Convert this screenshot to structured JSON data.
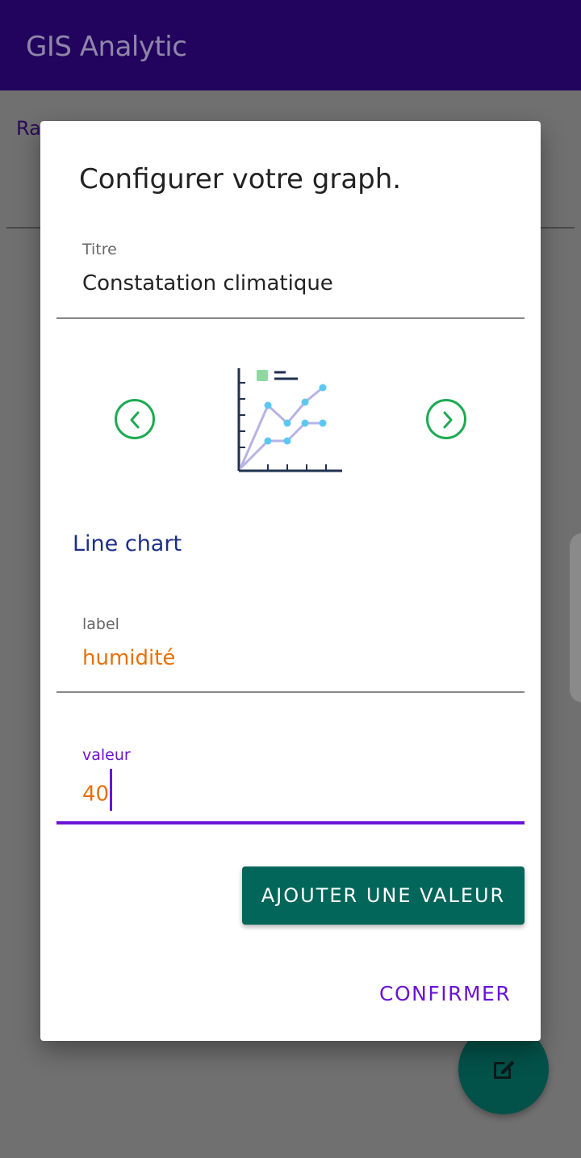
{
  "app": {
    "title": "GIS Analytic"
  },
  "background": {
    "tab_label": "Ra"
  },
  "dialog": {
    "title": "Configurer votre graph.",
    "title_field": {
      "label": "Titre",
      "value": "Constatation climatique"
    },
    "chart_selector": {
      "selected_type": "Line chart",
      "icon": "line-chart-icon"
    },
    "label_field": {
      "label": "label",
      "value": "humidité"
    },
    "value_field": {
      "label": "valeur",
      "value": "40"
    },
    "add_button_label": "AJOUTER UNE VALEUR",
    "confirm_button_label": "CONFIRMER"
  },
  "colors": {
    "appbar": "#22045f",
    "accent": "#6a14d6",
    "primary_button": "#03665a",
    "nav_arrow": "#1faa54",
    "input_text": "#e8700a",
    "chart_type_text": "#1c2f86"
  }
}
